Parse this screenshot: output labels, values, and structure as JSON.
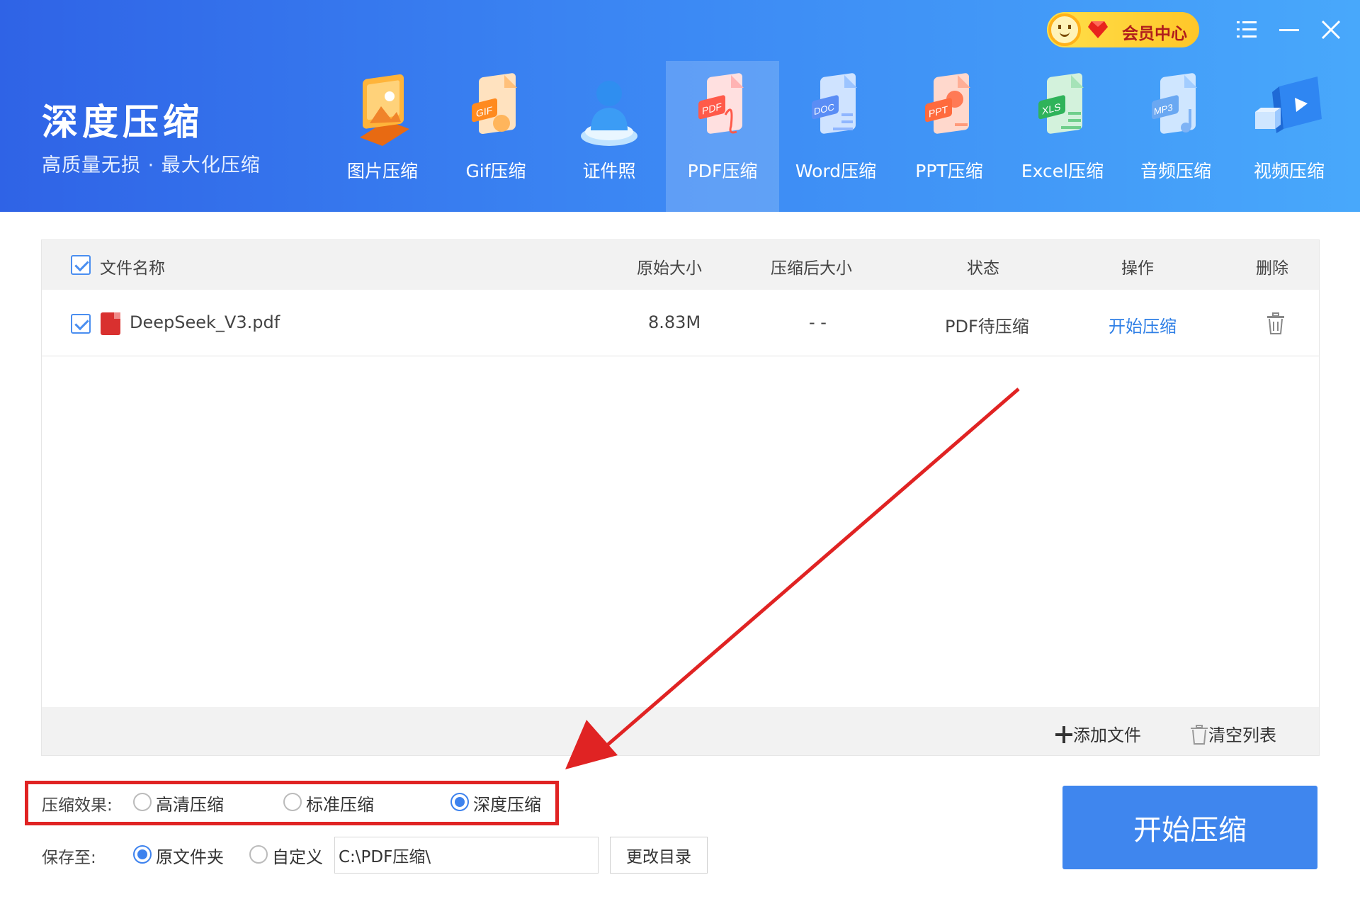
{
  "app": {
    "title": "深度压缩",
    "subtitle": "高质量无损 · 最大化压缩"
  },
  "vip": {
    "label": "会员中心"
  },
  "window_controls": [
    "menu-icon",
    "minimize-icon",
    "close-icon"
  ],
  "nav": {
    "active": "PDF压缩",
    "items": [
      {
        "label": "图片压缩",
        "icon": "image-compress-icon"
      },
      {
        "label": "Gif压缩",
        "icon": "gif-compress-icon"
      },
      {
        "label": "证件照",
        "icon": "id-photo-icon"
      },
      {
        "label": "PDF压缩",
        "icon": "pdf-compress-icon"
      },
      {
        "label": "Word压缩",
        "icon": "word-compress-icon"
      },
      {
        "label": "PPT压缩",
        "icon": "ppt-compress-icon"
      },
      {
        "label": "Excel压缩",
        "icon": "excel-compress-icon"
      },
      {
        "label": "音频压缩",
        "icon": "audio-compress-icon"
      },
      {
        "label": "视频压缩",
        "icon": "video-compress-icon"
      }
    ]
  },
  "table": {
    "columns": {
      "name": "文件名称",
      "original_size": "原始大小",
      "compressed_size": "压缩后大小",
      "status": "状态",
      "action": "操作",
      "delete": "删除"
    },
    "rows": [
      {
        "checked": true,
        "name": "DeepSeek_V3.pdf",
        "original_size": "8.83M",
        "compressed_size": "- -",
        "status": "PDF待压缩",
        "action": "开始压缩"
      }
    ],
    "footer": {
      "add_file": "添加文件",
      "clear_list": "清空列表"
    }
  },
  "options": {
    "effect_label": "压缩效果:",
    "effects": [
      {
        "label": "高清压缩",
        "selected": false
      },
      {
        "label": "标准压缩",
        "selected": false
      },
      {
        "label": "深度压缩",
        "selected": true
      }
    ],
    "save_label": "保存至:",
    "save_options": [
      {
        "label": "原文件夹",
        "selected": true
      },
      {
        "label": "自定义",
        "selected": false
      }
    ],
    "save_path": "C:\\PDF压缩\\",
    "change_dir": "更改目录"
  },
  "start_button": "开始压缩",
  "colors": {
    "header_start": "#2f63e6",
    "header_end": "#48a8fb",
    "accent": "#3f86ee",
    "link": "#2f7fe6",
    "highlight": "#e02323"
  }
}
